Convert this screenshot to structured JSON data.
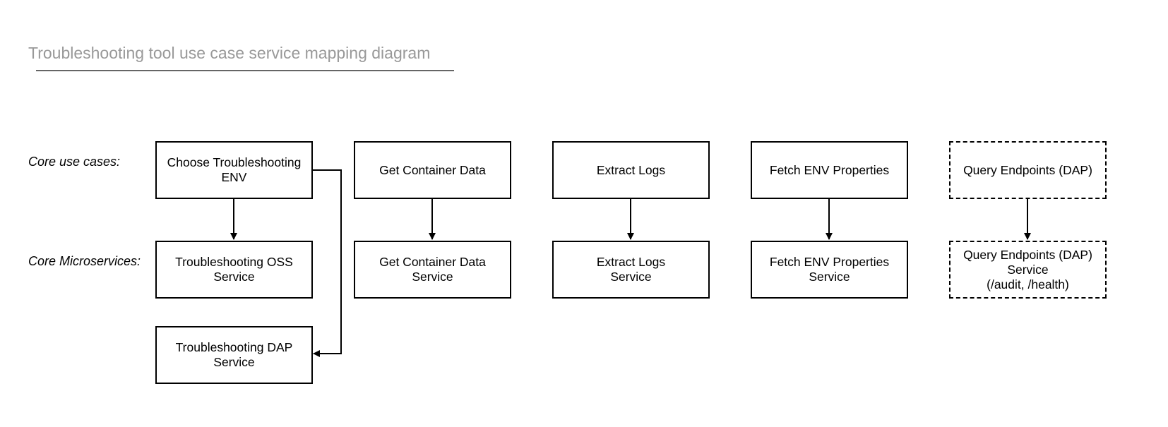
{
  "title": "Troubleshooting tool use case service mapping diagram",
  "row_labels": {
    "use_cases": "Core use cases:",
    "microservices": "Core Microservices:"
  },
  "use_cases": [
    {
      "id": "choose-env",
      "label": "Choose Troubleshooting ENV",
      "style": "solid"
    },
    {
      "id": "get-container-data",
      "label": "Get Container Data",
      "style": "solid"
    },
    {
      "id": "extract-logs",
      "label": "Extract Logs",
      "style": "solid"
    },
    {
      "id": "fetch-env-properties",
      "label": "Fetch ENV Properties",
      "style": "solid"
    },
    {
      "id": "query-endpoints",
      "label": "Query Endpoints (DAP)",
      "style": "dashed"
    }
  ],
  "services": [
    {
      "id": "troubleshooting-oss-service",
      "label": "Troubleshooting OSS\nService",
      "style": "solid"
    },
    {
      "id": "get-container-data-service",
      "label": "Get Container Data\nService",
      "style": "solid"
    },
    {
      "id": "extract-logs-service",
      "label": "Extract Logs\nService",
      "style": "solid"
    },
    {
      "id": "fetch-env-properties-service",
      "label": "Fetch ENV Properties\nService",
      "style": "solid"
    },
    {
      "id": "query-endpoints-service",
      "label": "Query Endpoints (DAP)\nService\n(/audit, /health)",
      "style": "dashed"
    },
    {
      "id": "troubleshooting-dap-service",
      "label": "Troubleshooting DAP\nService",
      "style": "solid"
    }
  ],
  "edges": [
    {
      "from": "choose-env",
      "to": "troubleshooting-oss-service"
    },
    {
      "from": "choose-env",
      "to": "troubleshooting-dap-service"
    },
    {
      "from": "get-container-data",
      "to": "get-container-data-service"
    },
    {
      "from": "extract-logs",
      "to": "extract-logs-service"
    },
    {
      "from": "fetch-env-properties",
      "to": "fetch-env-properties-service"
    },
    {
      "from": "query-endpoints",
      "to": "query-endpoints-service"
    }
  ]
}
